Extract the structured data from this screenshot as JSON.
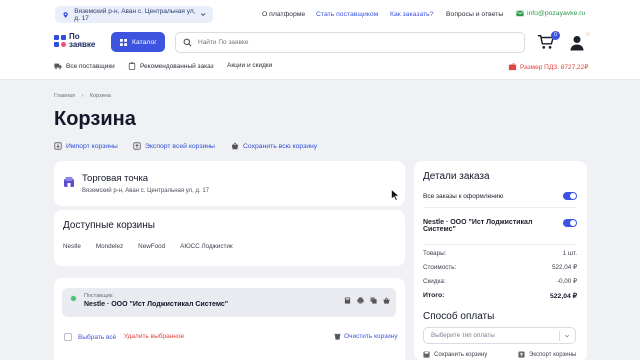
{
  "topbar": {
    "address": "Вяземский р-н, Аван с. Центральная ул, д. 17",
    "links": [
      "О платформе",
      "Стать поставщиком",
      "Как заказать?",
      "Вопросы и ответы"
    ],
    "email": "info@pozayavke.ru"
  },
  "header": {
    "logo_line1": "По",
    "logo_line2": "заявке",
    "catalog_label": "Каталог",
    "search_placeholder": "Найти По заявке",
    "cart_count": "0",
    "user_badge": "☆"
  },
  "subnav": {
    "items": [
      "Все поставщики",
      "Рекомендованный заказ",
      "Акции и скидки"
    ],
    "pdz": "Размер ПДЗ: 8727,22₽"
  },
  "breadcrumb": [
    "Главная",
    "Корзина"
  ],
  "page": {
    "title": "Корзина",
    "actions": [
      "Импорт корзины",
      "Экспорт всей корзины",
      "Сохранить всю корзину"
    ]
  },
  "store": {
    "title": "Торговая точка",
    "address": "Вяземский р-н, Аван с. Центральная ул, д. 17"
  },
  "available": {
    "title": "Доступные корзины",
    "chips": [
      "Nestle",
      "Mondelez",
      "NewFood",
      "АЮСС Лоджистик"
    ]
  },
  "supplier": {
    "label": "Поставщик:",
    "name": "Nestle · ООО \"Ист Лоджистикал Системс\""
  },
  "selection": {
    "select_all": "Выбрать всё",
    "delete_selected": "Удалить выбранное",
    "clear_cart": "Очистить корзину"
  },
  "order": {
    "title": "Детали заказа",
    "all_to_checkout": "Все заказы к оформлению",
    "all_to_checkout_on": true,
    "supplier_line1": "Nestle · ООО \"Ист Лоджистикал",
    "supplier_line2": "Системс\"",
    "supplier_on": true,
    "rows": [
      {
        "label": "Товары:",
        "value": "1 шт."
      },
      {
        "label": "Стоимость:",
        "value": "522,04 ₽"
      },
      {
        "label": "Скидка:",
        "value": "-0,00 ₽"
      }
    ],
    "total_label": "Итого:",
    "total_value": "522,04 ₽",
    "payment_title": "Способ оплаты",
    "payment_placeholder": "Выберите тип оплаты",
    "save_cart": "Сохранить корзину",
    "export_cart": "Экспорт корзины"
  },
  "colors": {
    "accent": "#3d54e0",
    "danger": "#e0453f",
    "success": "#4fbe77"
  }
}
